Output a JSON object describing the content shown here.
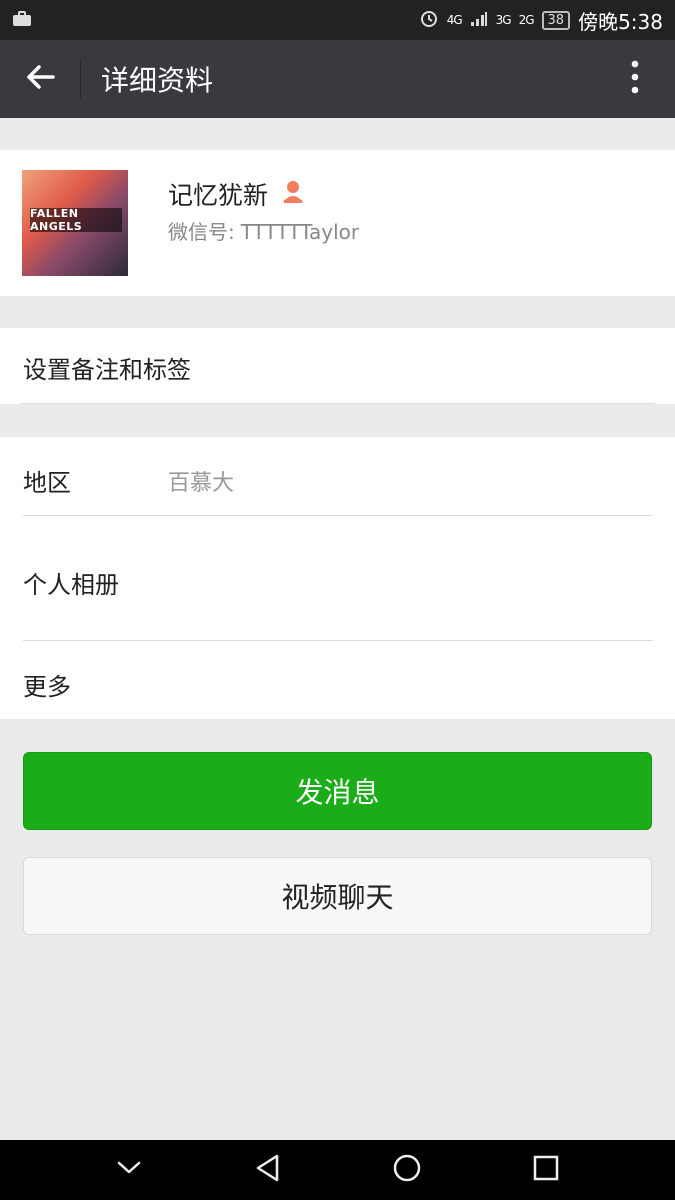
{
  "status_bar": {
    "network_4g": "4G",
    "network_3g": "3G",
    "network_2g": "2G",
    "battery": "38",
    "time": "傍晚5:38",
    "icons": [
      "briefcase-icon",
      "alarm-icon",
      "signal-icon",
      "battery-icon"
    ]
  },
  "header": {
    "title": "详细资料",
    "icons": [
      "back-arrow-icon",
      "more-vertical-icon"
    ]
  },
  "profile": {
    "avatar_text": "FALLEN ANGELS",
    "nickname": "记忆犹新",
    "wechat_id_label": "微信号:",
    "wechat_id": "TTTTTTaylor",
    "gender_icon": "female-icon",
    "gender_color": "#f37e5f"
  },
  "remark_row": {
    "label": "设置备注和标签"
  },
  "info_rows": {
    "region_label": "地区",
    "region_value": "百慕大",
    "album_label": "个人相册",
    "more_label": "更多"
  },
  "actions": {
    "send_message": "发消息",
    "video_chat": "视频聊天"
  },
  "colors": {
    "accent_green": "#1aad19",
    "app_bar": "#393a3f",
    "background": "#ebebeb"
  },
  "nav_bar": {
    "icons": [
      "chevron-down-icon",
      "back-triangle-icon",
      "home-circle-icon",
      "recents-square-icon"
    ]
  }
}
